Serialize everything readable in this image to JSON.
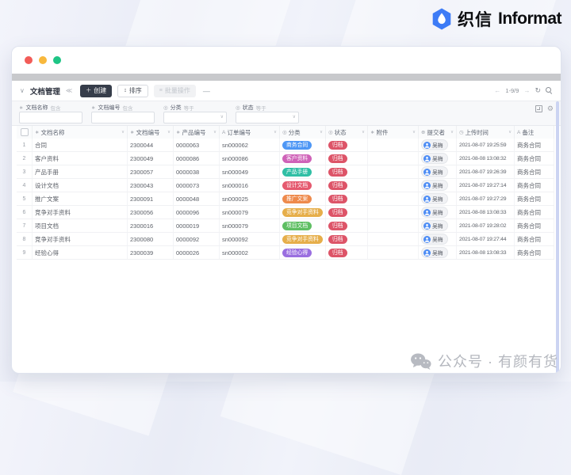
{
  "brand": {
    "cn": "织信",
    "en": "Informat"
  },
  "toolbar": {
    "title": "文档管理",
    "create_label": "创建",
    "sort_label": "排序",
    "batch_label": "批量操作",
    "more_label": "—",
    "pagination": "1-9/9",
    "prev_arrow": "←",
    "next_arrow": "→",
    "refresh_glyph": "↻"
  },
  "filters": [
    {
      "icon": "text-field-icon",
      "glyph": "∗",
      "label": "文档名称",
      "op": "包含",
      "type": "input",
      "value": "",
      "placeholder": ""
    },
    {
      "icon": "text-field-icon",
      "glyph": "∗",
      "label": "文档编号",
      "op": "包含",
      "type": "input",
      "value": "",
      "placeholder": ""
    },
    {
      "icon": "select-field-icon",
      "glyph": "◎",
      "label": "分类",
      "op": "等于",
      "type": "select",
      "value": ""
    },
    {
      "icon": "select-field-icon",
      "glyph": "◎",
      "label": "状态",
      "op": "等于",
      "type": "select",
      "value": ""
    }
  ],
  "table": {
    "columns": [
      {
        "key": "select",
        "label": "",
        "icon": "checkbox",
        "glyph": "",
        "sortable": false
      },
      {
        "key": "name",
        "label": "文档名称",
        "icon": "text-field-icon",
        "glyph": "∗",
        "sortable": true
      },
      {
        "key": "doc-no",
        "label": "文档编号",
        "icon": "text-field-icon",
        "glyph": "∗",
        "sortable": true
      },
      {
        "key": "product-no",
        "label": "产品编号",
        "icon": "text-field-icon",
        "glyph": "∗",
        "sortable": true
      },
      {
        "key": "order-no",
        "label": "订单编号",
        "icon": "text-icon",
        "glyph": "A",
        "sortable": true
      },
      {
        "key": "category",
        "label": "分类",
        "icon": "select-field-icon",
        "glyph": "◎",
        "sortable": true
      },
      {
        "key": "status",
        "label": "状态",
        "icon": "select-field-icon",
        "glyph": "◎",
        "sortable": true
      },
      {
        "key": "attachment",
        "label": "附件",
        "icon": "attachment-icon",
        "glyph": "∗",
        "sortable": true
      },
      {
        "key": "submitter",
        "label": "提交者",
        "icon": "person-icon",
        "glyph": "⊕",
        "sortable": true
      },
      {
        "key": "upload-time",
        "label": "上传时间",
        "icon": "clock-icon",
        "glyph": "◷",
        "sortable": true
      },
      {
        "key": "note",
        "label": "备注",
        "icon": "text-icon",
        "glyph": "A",
        "sortable": false
      }
    ],
    "rows": [
      {
        "index": "1",
        "name": "合同",
        "doc_no": "2300044",
        "product_no": "0000063",
        "order_no": "sn000062",
        "category": {
          "label": "商务合同",
          "color": "#4e97f5"
        },
        "status": {
          "label": "归档",
          "color": "#dd5468"
        },
        "attachment": "",
        "submitter": "吴梅",
        "uploaded_at": "2021-08-07 19:25:59",
        "note": "商务合同"
      },
      {
        "index": "2",
        "name": "客户资料",
        "doc_no": "2300049",
        "product_no": "0000086",
        "order_no": "sn000086",
        "category": {
          "label": "客户资料",
          "color": "#cf62b8"
        },
        "status": {
          "label": "归档",
          "color": "#dd5468"
        },
        "attachment": "",
        "submitter": "吴梅",
        "uploaded_at": "2021-08-08 13:08:32",
        "note": "商务合同"
      },
      {
        "index": "3",
        "name": "产品手册",
        "doc_no": "2300057",
        "product_no": "0000038",
        "order_no": "sn000049",
        "category": {
          "label": "产品手册",
          "color": "#30bfa5"
        },
        "status": {
          "label": "归档",
          "color": "#dd5468"
        },
        "attachment": "",
        "submitter": "吴梅",
        "uploaded_at": "2021-08-07 19:26:39",
        "note": "商务合同"
      },
      {
        "index": "4",
        "name": "设计文档",
        "doc_no": "2300043",
        "product_no": "0000073",
        "order_no": "sn000016",
        "category": {
          "label": "设计文档",
          "color": "#e55a6f"
        },
        "status": {
          "label": "归档",
          "color": "#dd5468"
        },
        "attachment": "",
        "submitter": "吴梅",
        "uploaded_at": "2021-08-07 19:27:14",
        "note": "商务合同"
      },
      {
        "index": "5",
        "name": "推广文案",
        "doc_no": "2300091",
        "product_no": "0000048",
        "order_no": "sn000025",
        "category": {
          "label": "推广文案",
          "color": "#ee8a4c"
        },
        "status": {
          "label": "归档",
          "color": "#dd5468"
        },
        "attachment": "",
        "submitter": "吴梅",
        "uploaded_at": "2021-08-07 19:27:29",
        "note": "商务合同"
      },
      {
        "index": "6",
        "name": "竞争对手资料",
        "doc_no": "2300056",
        "product_no": "0000096",
        "order_no": "sn000079",
        "category": {
          "label": "竞争对手资料",
          "color": "#e6ae4a"
        },
        "status": {
          "label": "归档",
          "color": "#dd5468"
        },
        "attachment": "",
        "submitter": "吴梅",
        "uploaded_at": "2021-08-08 13:08:33",
        "note": "商务合同"
      },
      {
        "index": "7",
        "name": "项目文档",
        "doc_no": "2300016",
        "product_no": "0000019",
        "order_no": "sn000079",
        "category": {
          "label": "项目文档",
          "color": "#5fbf63"
        },
        "status": {
          "label": "归档",
          "color": "#dd5468"
        },
        "attachment": "",
        "submitter": "吴梅",
        "uploaded_at": "2021-08-07 19:28:02",
        "note": "商务合同"
      },
      {
        "index": "8",
        "name": "竞争对手资料",
        "doc_no": "2300080",
        "product_no": "0000092",
        "order_no": "sn000092",
        "category": {
          "label": "竞争对手资料",
          "color": "#e6ae4a"
        },
        "status": {
          "label": "归档",
          "color": "#dd5468"
        },
        "attachment": "",
        "submitter": "吴梅",
        "uploaded_at": "2021-08-07 19:27:44",
        "note": "商务合同"
      },
      {
        "index": "9",
        "name": "经验心得",
        "doc_no": "2300039",
        "product_no": "0000026",
        "order_no": "sn000002",
        "category": {
          "label": "经验心得",
          "color": "#9a6fe0"
        },
        "status": {
          "label": "归档",
          "color": "#dd5468"
        },
        "attachment": "",
        "submitter": "吴梅",
        "uploaded_at": "2021-08-08 13:08:33",
        "note": "商务合同"
      }
    ]
  },
  "watermark": {
    "text": "公众号 · 有颜有货"
  }
}
